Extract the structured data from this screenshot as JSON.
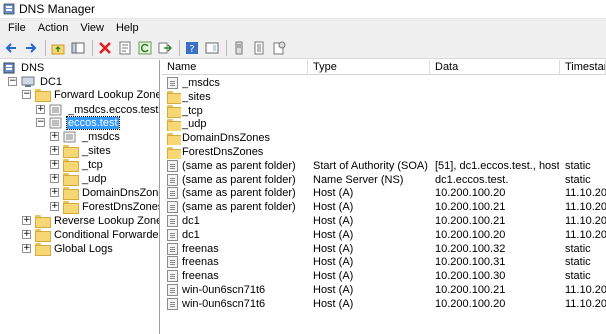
{
  "window": {
    "title": "DNS Manager"
  },
  "menu": [
    "File",
    "Action",
    "View",
    "Help"
  ],
  "toolbar_icons": [
    "back-icon",
    "forward-icon",
    "up-folder-icon",
    "show-tree-icon",
    "delete-icon",
    "properties-icon",
    "refresh-icon",
    "export-icon",
    "help-icon",
    "console-icon",
    "server-icon",
    "list-icon",
    "record-icon"
  ],
  "tree": [
    {
      "label": "DNS",
      "expander": "",
      "icon": "dns-icon"
    },
    {
      "label": "DC1",
      "expander": "−",
      "icon": "server-icon"
    },
    {
      "label": "Forward Lookup Zones",
      "expander": "−",
      "icon": "folder-icon"
    },
    {
      "label": "_msdcs.eccos.test",
      "expander": "+",
      "icon": "zone-icon"
    },
    {
      "label": "eccos.test",
      "expander": "−",
      "icon": "zone-icon",
      "selected": true
    },
    {
      "label": "_msdcs",
      "expander": "+",
      "icon": "zone-icon"
    },
    {
      "label": "_sites",
      "expander": "+",
      "icon": "folder-icon"
    },
    {
      "label": "_tcp",
      "expander": "+",
      "icon": "folder-icon"
    },
    {
      "label": "_udp",
      "expander": "+",
      "icon": "folder-icon"
    },
    {
      "label": "DomainDnsZones",
      "expander": "+",
      "icon": "folder-icon"
    },
    {
      "label": "ForestDnsZones",
      "expander": "+",
      "icon": "folder-icon"
    },
    {
      "label": "Reverse Lookup Zones",
      "expander": "+",
      "icon": "folder-icon"
    },
    {
      "label": "Conditional Forwarders",
      "expander": "+",
      "icon": "folder-icon"
    },
    {
      "label": "Global Logs",
      "expander": "+",
      "icon": "logs-icon"
    }
  ],
  "columns": [
    "Name",
    "Type",
    "Data",
    "Timestamp"
  ],
  "rows": [
    {
      "icon": "zone-icon",
      "name": "_msdcs",
      "type": "",
      "data": "",
      "ts": ""
    },
    {
      "icon": "folder-icon",
      "name": "_sites",
      "type": "",
      "data": "",
      "ts": ""
    },
    {
      "icon": "folder-icon",
      "name": "_tcp",
      "type": "",
      "data": "",
      "ts": ""
    },
    {
      "icon": "folder-icon",
      "name": "_udp",
      "type": "",
      "data": "",
      "ts": ""
    },
    {
      "icon": "folder-icon",
      "name": "DomainDnsZones",
      "type": "",
      "data": "",
      "ts": ""
    },
    {
      "icon": "folder-icon",
      "name": "ForestDnsZones",
      "type": "",
      "data": "",
      "ts": ""
    },
    {
      "icon": "record-icon",
      "name": "(same as parent folder)",
      "type": "Start of Authority (SOA)",
      "data": "[51], dc1.eccos.test., host...",
      "ts": "static"
    },
    {
      "icon": "record-icon",
      "name": "(same as parent folder)",
      "type": "Name Server (NS)",
      "data": "dc1.eccos.test.",
      "ts": "static"
    },
    {
      "icon": "record-icon",
      "name": "(same as parent folder)",
      "type": "Host (A)",
      "data": "10.200.100.20",
      "ts": "11.10.20"
    },
    {
      "icon": "record-icon",
      "name": "(same as parent folder)",
      "type": "Host (A)",
      "data": "10.200.100.21",
      "ts": "11.10.20"
    },
    {
      "icon": "record-icon",
      "name": "dc1",
      "type": "Host (A)",
      "data": "10.200.100.21",
      "ts": "11.10.20"
    },
    {
      "icon": "record-icon",
      "name": "dc1",
      "type": "Host (A)",
      "data": "10.200.100.20",
      "ts": "11.10.20"
    },
    {
      "icon": "record-icon",
      "name": "freenas",
      "type": "Host (A)",
      "data": "10.200.100.32",
      "ts": "static"
    },
    {
      "icon": "record-icon",
      "name": "freenas",
      "type": "Host (A)",
      "data": "10.200.100.31",
      "ts": "static"
    },
    {
      "icon": "record-icon",
      "name": "freenas",
      "type": "Host (A)",
      "data": "10.200.100.30",
      "ts": "static"
    },
    {
      "icon": "record-icon",
      "name": "win-0un6scn71t6",
      "type": "Host (A)",
      "data": "10.200.100.21",
      "ts": "11.10.20"
    },
    {
      "icon": "record-icon",
      "name": "win-0un6scn71t6",
      "type": "Host (A)",
      "data": "10.200.100.20",
      "ts": "11.10.20"
    }
  ]
}
